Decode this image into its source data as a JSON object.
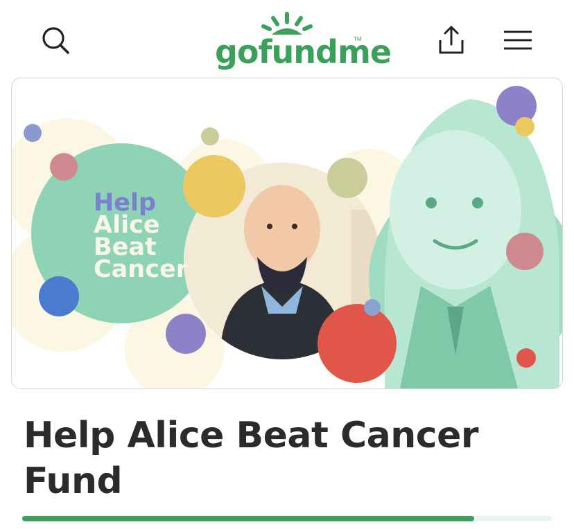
{
  "header": {
    "logo_text": "gofundme",
    "logo_tm": "TM",
    "search_icon": "search-icon",
    "share_icon": "share-icon",
    "menu_icon": "menu-icon"
  },
  "hero": {
    "banner_lines": [
      "Help",
      "Alice",
      "Beat",
      "Cancer"
    ]
  },
  "campaign": {
    "title": "Help Alice Beat Cancer Fund",
    "progress_fraction": 0.853
  },
  "colors": {
    "brand_green": "#3aa05a",
    "banner_help": "#7b7fcf",
    "banner_text": "#f8f6e8",
    "mint": "#8fd3b6",
    "title_text": "#2b2b2b",
    "progress_fill": "#3d9e5d",
    "progress_track": "#e6f5ee"
  }
}
